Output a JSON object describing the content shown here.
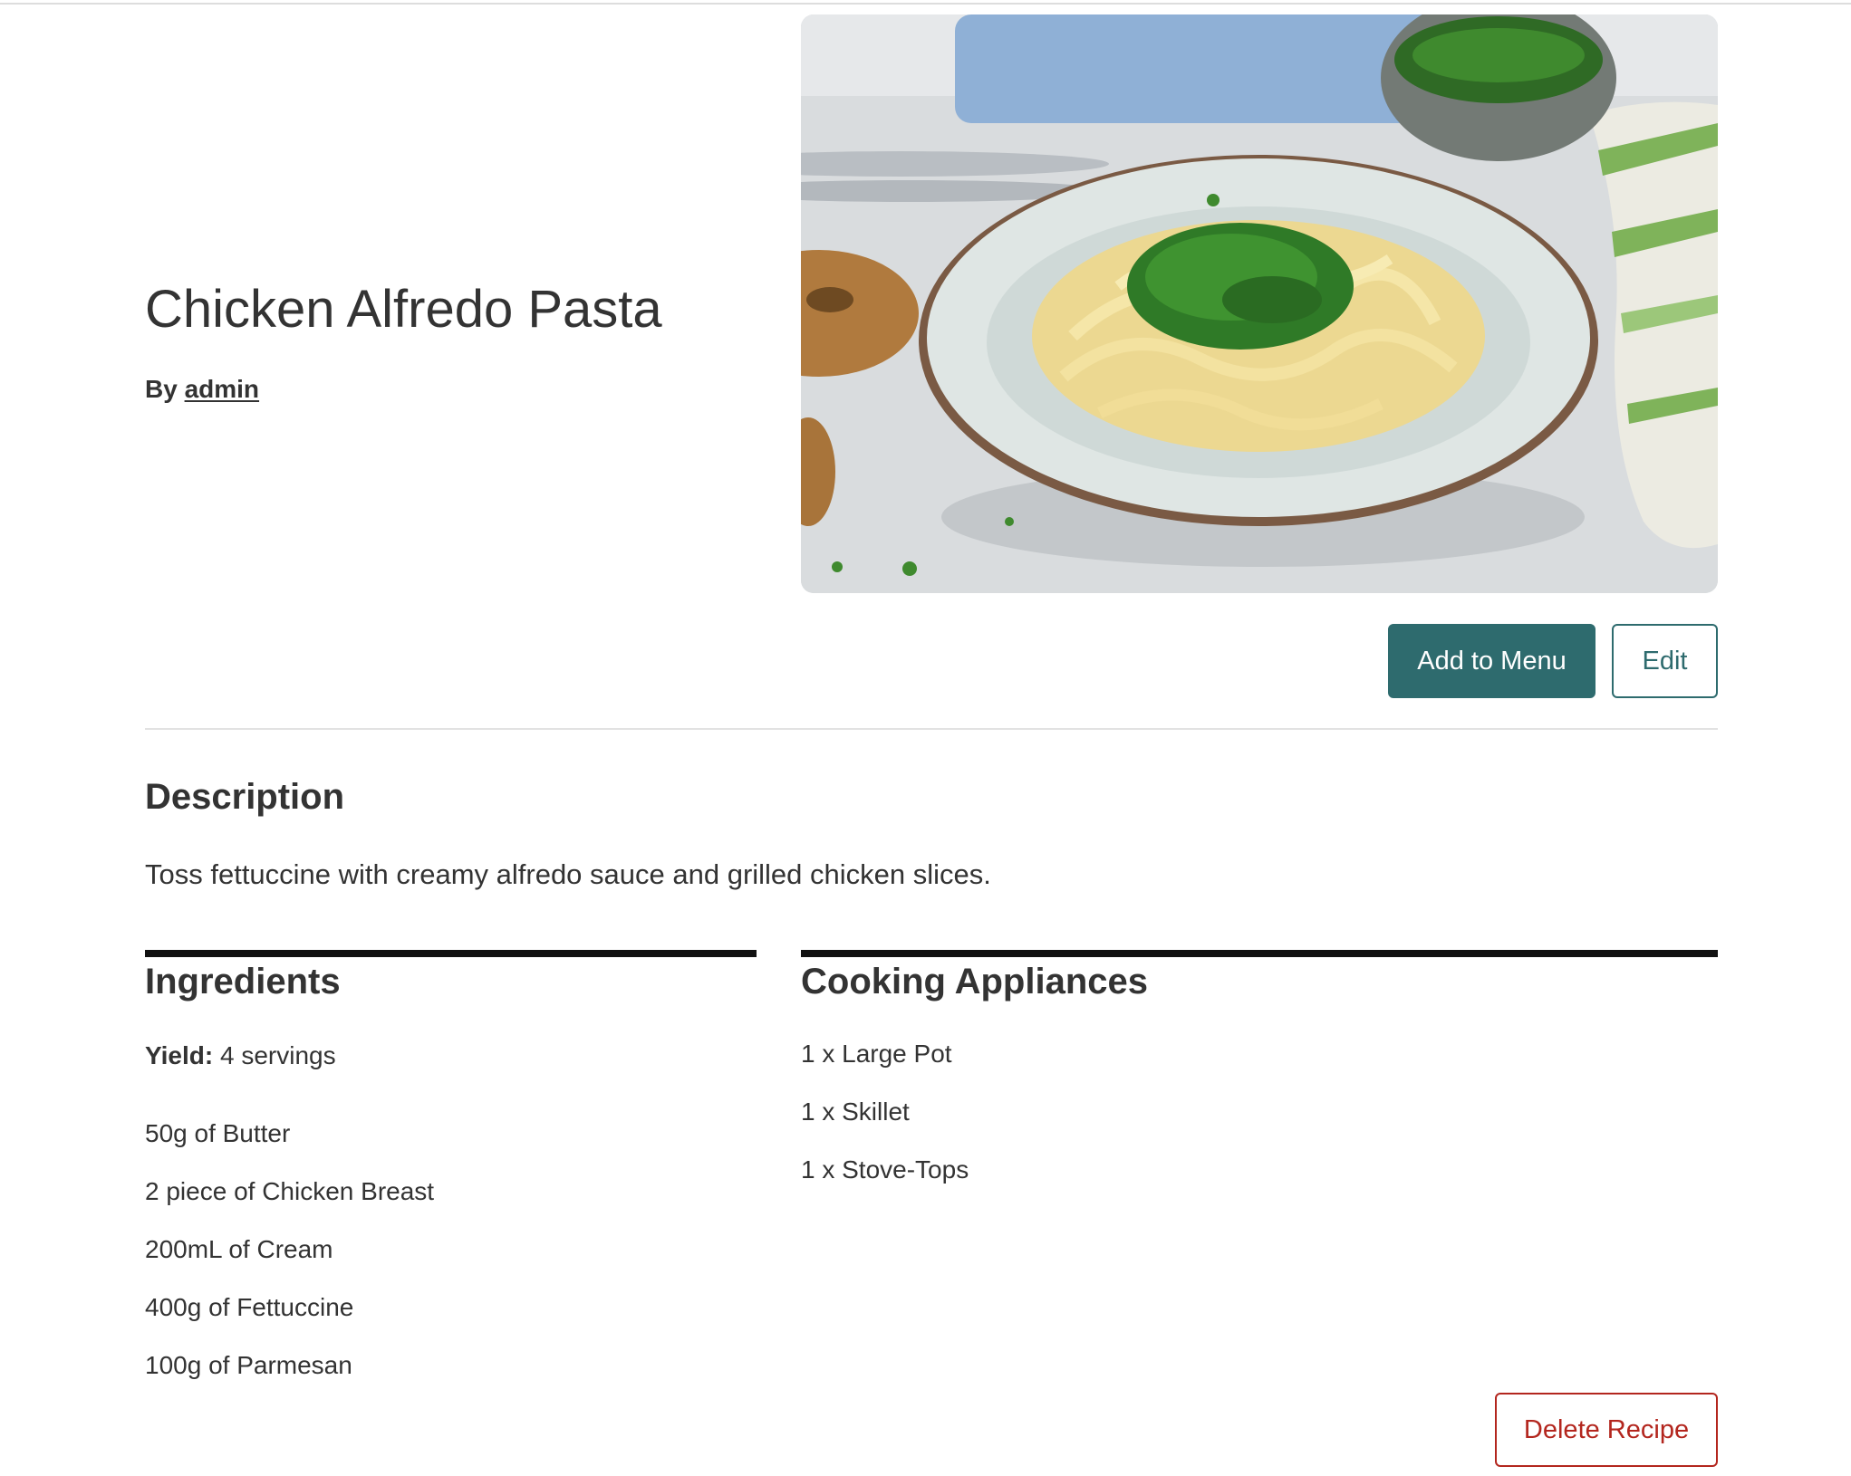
{
  "recipe": {
    "title": "Chicken Alfredo Pasta",
    "by_prefix": "By",
    "author": "admin",
    "image_alt": "Bowl of fettuccine alfredo topped with chopped parsley"
  },
  "actions": {
    "add_to_menu": "Add to Menu",
    "edit": "Edit",
    "delete": "Delete Recipe"
  },
  "description": {
    "heading": "Description",
    "text": "Toss fettuccine with creamy alfredo sauce and grilled chicken slices."
  },
  "ingredients": {
    "heading": "Ingredients",
    "yield_label": "Yield:",
    "yield_value": "4 servings",
    "items": [
      "50g of Butter",
      "2 piece of Chicken Breast",
      "200mL of Cream",
      "400g of Fettuccine",
      "100g of Parmesan"
    ]
  },
  "appliances": {
    "heading": "Cooking Appliances",
    "items": [
      "1 x Large Pot",
      "1 x Skillet",
      "1 x Stove-Tops"
    ]
  },
  "colors": {
    "primary": "#2e6b6e",
    "danger": "#b3261e",
    "text": "#333333"
  }
}
